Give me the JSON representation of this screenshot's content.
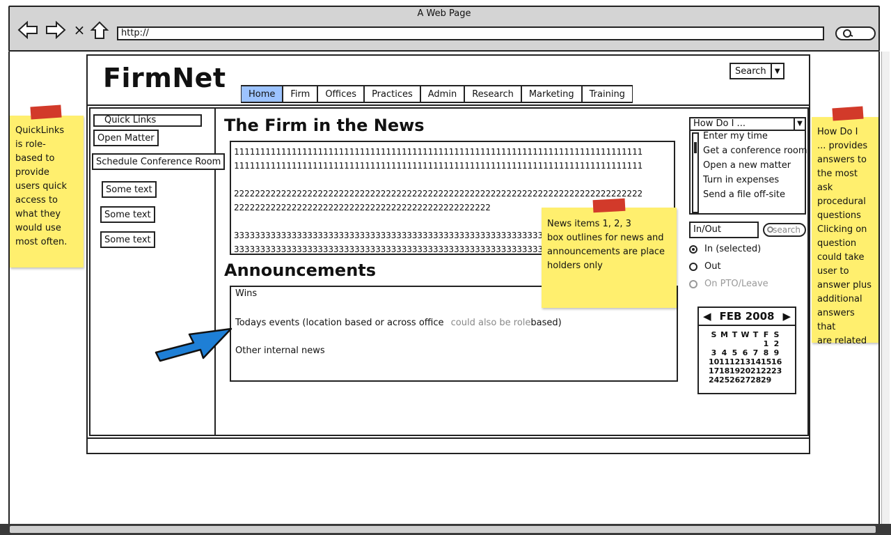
{
  "browser": {
    "window_title": "A Web Page",
    "url": "http://"
  },
  "app": {
    "logo": "FirmNet",
    "search_label": "Search",
    "tabs": [
      "Home",
      "Firm",
      "Offices",
      "Practices",
      "Admin",
      "Research",
      "Marketing",
      "Training"
    ],
    "active_tab": "Home"
  },
  "sidebar": {
    "title": "Quick Links",
    "buttons": [
      "Open Matter",
      "Schedule Conference Room",
      "Some text",
      "Some text",
      "Some text"
    ]
  },
  "news": {
    "title": "The Firm in the News",
    "lines": [
      "111111111111111111111111111111111111111111111111111111111111111111111111111111",
      "111111111111111111111111111111111111111111111111111111111111111111111111111111",
      "",
      "222222222222222222222222222222222222222222222222222222222222222222222222222222",
      "2222222222222222222222222222222222222222222222222",
      "",
      "333333333333333333333333333333333333333333333333333333333333333333333333333333",
      "333333333333333333333333333333333333333333333333333333333333333333333333333333"
    ]
  },
  "announcements": {
    "title": "Announcements",
    "wins": "Wins",
    "events_text": "Todays events (location based or across office",
    "events_note": "could also be role",
    "events_suffix": "based)",
    "other": "Other internal news"
  },
  "howdo": {
    "title": "How Do I ...",
    "items": [
      "Enter my time",
      "Get a conference room",
      "Open a new matter",
      "Turn in expenses",
      "Send a file off-site"
    ]
  },
  "inout": {
    "field": "In/Out",
    "search_placeholder": "search",
    "options": [
      {
        "label": "In (selected)",
        "selected": true,
        "disabled": false
      },
      {
        "label": "Out",
        "selected": false,
        "disabled": false
      },
      {
        "label": "On PTO/Leave",
        "selected": false,
        "disabled": true
      }
    ]
  },
  "calendar": {
    "month": "FEB 2008",
    "weekdays": [
      "S",
      "M",
      "T",
      "W",
      "T",
      "F",
      "S"
    ],
    "weeks": [
      [
        "",
        "",
        "",
        "",
        "",
        "1",
        "2"
      ],
      [
        "3",
        "4",
        "5",
        "6",
        "7",
        "8",
        "9"
      ],
      [
        "10",
        "11",
        "12",
        "13",
        "14",
        "15",
        "16"
      ],
      [
        "17",
        "18",
        "19",
        "20",
        "21",
        "22",
        "23"
      ],
      [
        "24",
        "25",
        "26",
        "27",
        "28",
        "29",
        ""
      ]
    ]
  },
  "notes": {
    "left": [
      "QuickLinks",
      "is role-",
      "based to",
      "provide",
      "users quick",
      "access to",
      "what they",
      "would use",
      "most often."
    ],
    "center": [
      "News items 1, 2, 3",
      "box outlines for news and",
      "announcements are place",
      "holders only"
    ],
    "right": [
      "How Do I",
      "... provides",
      "answers to",
      "the most ask",
      "procedural",
      "questions",
      "Clicking on",
      "question",
      "could take",
      "user to",
      "answer plus",
      "additional",
      "answers that",
      "are related"
    ]
  },
  "colors": {
    "sticky": "#ffef6e",
    "tape": "#d23a2a",
    "active_tab": "#9cc3ff",
    "arrow": "#1e7fd6"
  }
}
